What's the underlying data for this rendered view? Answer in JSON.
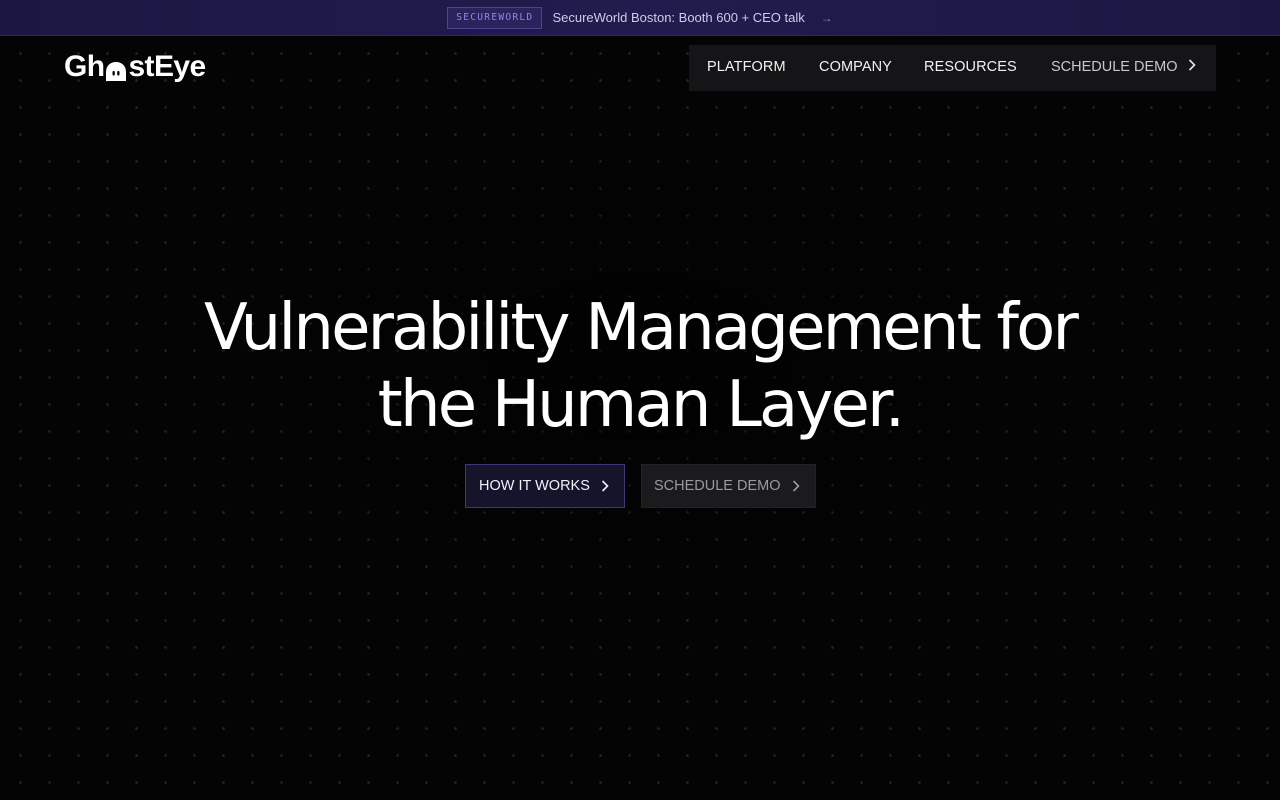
{
  "banner": {
    "badge": "SECUREWORLD",
    "text": "SecureWorld Boston: Booth 600 + CEO talk",
    "arrow": "→"
  },
  "logo": {
    "prefix": "Gh",
    "suffix": "stEye",
    "icon": "ghost-icon"
  },
  "nav": {
    "items": [
      "PLATFORM",
      "COMPANY",
      "RESOURCES"
    ],
    "cta_label": "SCHEDULE DEMO",
    "cta_icon": "chevron-right-icon"
  },
  "hero": {
    "title_line1": "Vulnerability Management for",
    "title_line2": "the Human Layer.",
    "primary_button": "HOW IT WORKS",
    "secondary_button": "SCHEDULE DEMO"
  },
  "colors": {
    "background": "#040405",
    "banner": "#1f1a48",
    "accent": "#8f87e6",
    "nav_bg": "#151517"
  }
}
